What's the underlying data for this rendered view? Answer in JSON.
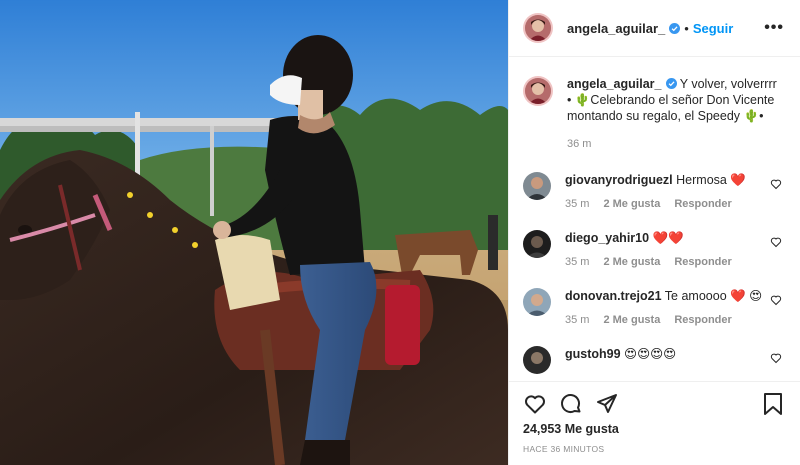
{
  "post": {
    "username": "angela_aguilar_",
    "follow_label": "Seguir",
    "separator": "•",
    "more_label": "•••",
    "caption_text": "Y volver, volverrrr • 🌵Celebrando el señor Don Vicente montando su regalo, el Speedy 🌵•",
    "caption_time": "36 m",
    "likes": "24,953 Me gusta",
    "posted": "HACE 36 MINUTOS"
  },
  "comments": [
    {
      "username": "giovanyrodriguezl",
      "text": "Hermosa ❤️",
      "time": "35 m",
      "likes": "2 Me gusta",
      "reply": "Responder"
    },
    {
      "username": "diego_yahir10",
      "text": "❤️❤️",
      "time": "35 m",
      "likes": "2 Me gusta",
      "reply": "Responder"
    },
    {
      "username": "donovan.trejo21",
      "text": "Te amoooo ❤️ 😍",
      "time": "35 m",
      "likes": "2 Me gusta",
      "reply": "Responder"
    },
    {
      "username": "gustoh99",
      "text": "😍😍😍😍"
    }
  ],
  "icons": {
    "verified": "verified-badge-icon",
    "like": "heart-icon",
    "comment": "comment-bubble-icon",
    "share": "paper-plane-icon",
    "save": "bookmark-icon"
  },
  "colors": {
    "accent": "#0095f6",
    "text": "#262626",
    "muted": "#8e8e8e",
    "heart": "#ed4956"
  }
}
